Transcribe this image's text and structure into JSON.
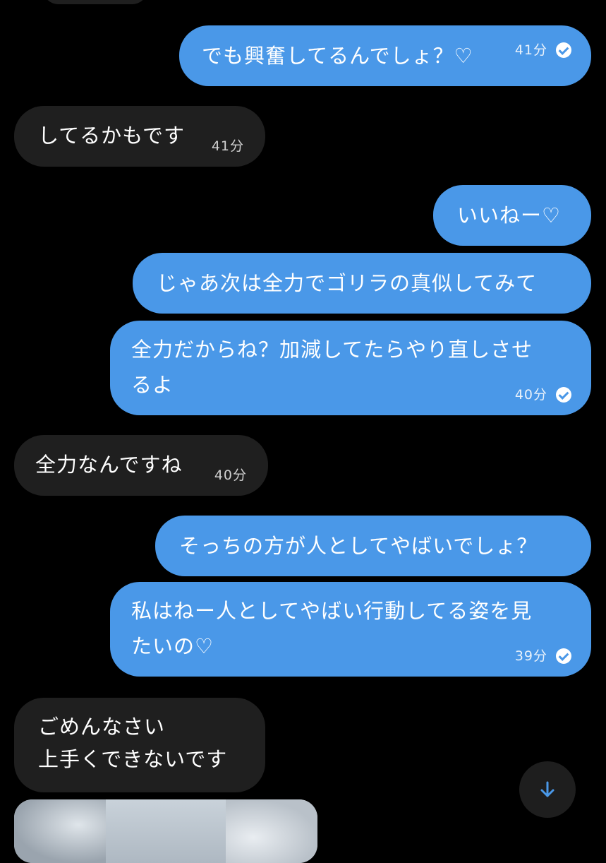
{
  "messages": [
    {
      "id": "m1",
      "direction": "out",
      "lines": [
        "でも興奮してるんでしょ？♡"
      ],
      "time": "41分",
      "read": true
    },
    {
      "id": "m2",
      "direction": "in",
      "lines": [
        "してるかもです"
      ],
      "time": "41分"
    },
    {
      "id": "m3",
      "direction": "out",
      "lines": [
        "いいねー♡"
      ]
    },
    {
      "id": "m4",
      "direction": "out",
      "lines": [
        "じゃあ次は全力でゴリラの真似してみて"
      ]
    },
    {
      "id": "m5",
      "direction": "out",
      "lines": [
        "全力だからね？加減してたらやり直しさせ",
        "るよ"
      ],
      "time": "40分",
      "read": true
    },
    {
      "id": "m6",
      "direction": "in",
      "lines": [
        "全力なんですね"
      ],
      "time": "40分"
    },
    {
      "id": "m7",
      "direction": "out",
      "lines": [
        "そっちの方が人としてやばいでしょ？"
      ]
    },
    {
      "id": "m8",
      "direction": "out",
      "lines": [
        "私はねー人としてやばい行動してる姿を見",
        "たいの♡"
      ],
      "time": "39分",
      "read": true
    },
    {
      "id": "m9",
      "direction": "in",
      "lines": [
        "ごめんなさい",
        "上手くできないです"
      ]
    }
  ],
  "icons": {
    "read_receipt": "check-circle-icon",
    "scroll_down": "arrow-down-icon"
  },
  "colors": {
    "background": "#000000",
    "outgoing_bubble": "#4a98e8",
    "incoming_bubble": "#1f1f1f",
    "scroll_arrow": "#4a98e8"
  }
}
